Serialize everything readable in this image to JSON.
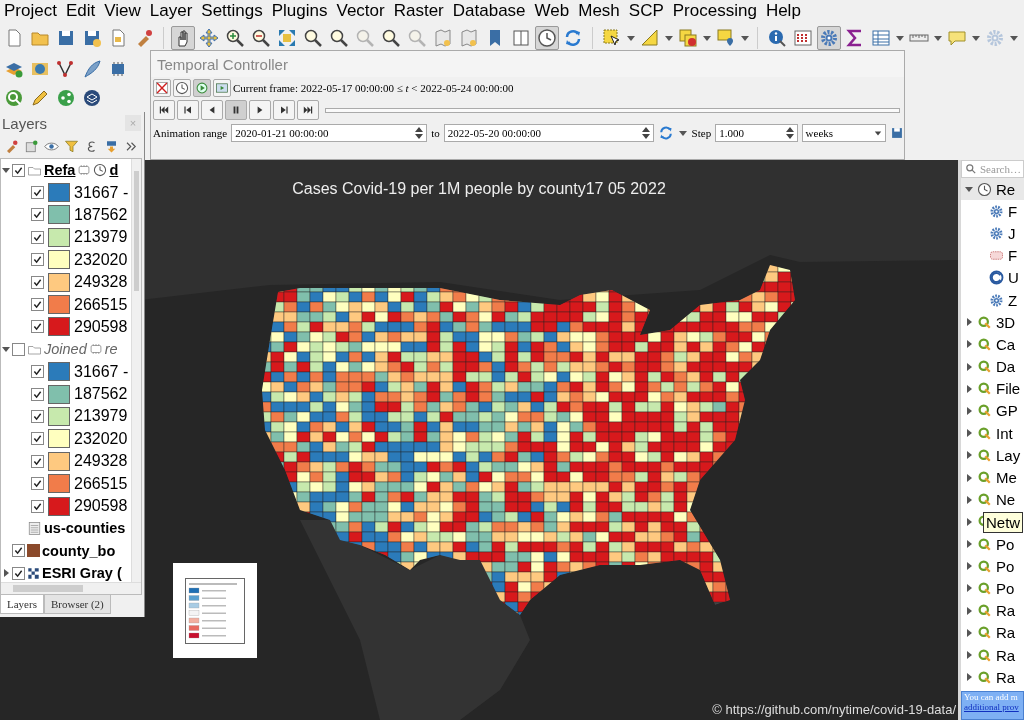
{
  "menu": [
    "Project",
    "Edit",
    "View",
    "Layer",
    "Settings",
    "Plugins",
    "Vector",
    "Raster",
    "Database",
    "Web",
    "Mesh",
    "SCP",
    "Processing",
    "Help"
  ],
  "toolbar": [
    {
      "pressed": false,
      "disabled": false
    },
    {
      "pressed": false,
      "disabled": false
    },
    {
      "pressed": false,
      "disabled": false
    },
    {
      "pressed": false,
      "disabled": false
    },
    {
      "pressed": false,
      "disabled": false
    },
    {
      "pressed": false,
      "disabled": false
    },
    {
      "pressed": true,
      "disabled": false
    },
    {
      "pressed": false,
      "disabled": false
    },
    {
      "pressed": false,
      "disabled": false
    },
    {
      "pressed": false,
      "disabled": false
    },
    {
      "pressed": false,
      "disabled": false
    },
    {
      "pressed": false,
      "disabled": false
    },
    {
      "pressed": false,
      "disabled": false
    },
    {
      "pressed": false,
      "disabled": true
    },
    {
      "pressed": false,
      "disabled": false
    },
    {
      "pressed": false,
      "disabled": true
    },
    {
      "pressed": false,
      "disabled": false
    },
    {
      "pressed": false,
      "disabled": false
    },
    {
      "pressed": false,
      "disabled": false
    },
    {
      "pressed": false,
      "disabled": false
    },
    {
      "pressed": true,
      "disabled": false
    },
    {
      "pressed": false,
      "disabled": false
    },
    {
      "pressed": false,
      "disabled": false
    },
    {
      "pressed": false,
      "disabled": false
    },
    {
      "pressed": false,
      "disabled": false
    },
    {
      "pressed": false,
      "disabled": false
    },
    {
      "pressed": false,
      "disabled": false
    },
    {
      "pressed": false,
      "disabled": false
    },
    {
      "pressed": true,
      "disabled": false
    },
    {
      "pressed": false,
      "disabled": false
    },
    {
      "pressed": false,
      "disabled": false
    },
    {
      "pressed": false,
      "disabled": false
    },
    {
      "pressed": false,
      "disabled": false
    },
    {
      "pressed": false,
      "disabled": true
    }
  ],
  "temporal": {
    "title": "Temporal Controller",
    "mode_buttons": [
      {
        "pressed": false
      },
      {
        "pressed": false
      },
      {
        "pressed": true
      },
      {
        "pressed": false
      }
    ],
    "current_frame": "Current frame: 2022-05-17 00:00:00 ≤ *t* < 2022-05-24 00:00:00",
    "timeline": {
      "level": 0
    },
    "playback_buttons": [
      {
        "pressed": false
      },
      {
        "pressed": false
      },
      {
        "pressed": false
      },
      {
        "pressed": true
      },
      {
        "pressed": false
      },
      {
        "pressed": false
      },
      {
        "pressed": false
      }
    ],
    "range_label": "Animation range",
    "range_start": "2020-01-21 00:00:00",
    "to_label": "to",
    "range_end": "2022-05-20 00:00:00",
    "step_label": "Step",
    "step": "1.000",
    "step_unit": "weeks"
  },
  "layers": {
    "title": "Layers",
    "close": "×",
    "tree": [
      {
        "kind": "group",
        "name": "Refa",
        "name_tail": "d",
        "checked": true,
        "expanded": true,
        "current": true,
        "temporal": true,
        "children": [
          {
            "label": "31667 -",
            "color": "#2b7bba",
            "checked": true
          },
          {
            "label": "187562",
            "color": "#80bfac",
            "checked": true
          },
          {
            "label": "213979",
            "color": "#c7e9ad",
            "checked": true
          },
          {
            "label": "232020",
            "color": "#ffffbf",
            "checked": true
          },
          {
            "label": "249328",
            "color": "#fec980",
            "checked": true
          },
          {
            "label": "266515",
            "color": "#f17c4a",
            "checked": true
          },
          {
            "label": "290598",
            "color": "#d7191c",
            "checked": true
          }
        ]
      },
      {
        "kind": "group",
        "name": "Joined",
        "name_tail": "re",
        "checked": false,
        "expanded": true,
        "current": false,
        "temporal": false,
        "children": [
          {
            "label": "31667 -",
            "color": "#2b7bba",
            "checked": true
          },
          {
            "label": "187562",
            "color": "#80bfac",
            "checked": true
          },
          {
            "label": "213979",
            "color": "#c7e9ad",
            "checked": true
          },
          {
            "label": "232020",
            "color": "#ffffbf",
            "checked": true
          },
          {
            "label": "249328",
            "color": "#fec980",
            "checked": true
          },
          {
            "label": "266515",
            "color": "#f17c4a",
            "checked": true
          },
          {
            "label": "290598",
            "color": "#d7191c",
            "checked": true
          }
        ]
      },
      {
        "kind": "table",
        "name": "us-counties"
      },
      {
        "kind": "vector",
        "name": "county_bo",
        "checked": true,
        "color": "#8b4a2b"
      },
      {
        "kind": "raster",
        "name": "ESRI Gray (",
        "checked": true,
        "expanded": false
      }
    ],
    "tabs": [
      {
        "label": "Layers",
        "selected": true
      },
      {
        "label": "Browser (2)",
        "selected": false
      }
    ]
  },
  "map": {
    "title": "Cases Covid-19 per 1M people by county17 05 2022",
    "attribution": "© https://github.com/nytime/covid-19-data/"
  },
  "browser": {
    "search_placeholder": "Search…",
    "items": [
      {
        "kind": "recent",
        "label": "Re",
        "expanded": true,
        "children": [
          {
            "kind": "gear",
            "label": "F"
          },
          {
            "kind": "gear",
            "label": "J"
          },
          {
            "kind": "grid",
            "label": "F"
          },
          {
            "kind": "globe",
            "label": "U"
          },
          {
            "kind": "gear",
            "label": "Z"
          }
        ]
      },
      {
        "kind": "qgis",
        "label": "3D",
        "expanded": false
      },
      {
        "kind": "qgis",
        "label": "Ca",
        "expanded": false
      },
      {
        "kind": "qgis",
        "label": "Da",
        "expanded": false
      },
      {
        "kind": "qgis",
        "label": "File",
        "expanded": false
      },
      {
        "kind": "qgis",
        "label": "GP",
        "expanded": false
      },
      {
        "kind": "qgis",
        "label": "Int",
        "expanded": false
      },
      {
        "kind": "qgis",
        "label": "Lay",
        "expanded": false
      },
      {
        "kind": "qgis",
        "label": "Me",
        "expanded": false
      },
      {
        "kind": "qgis",
        "label": "Ne",
        "expanded": false
      },
      {
        "kind": "qgis",
        "tooltip": "Netw",
        "expanded": false
      },
      {
        "kind": "qgis",
        "label": "Po",
        "expanded": false
      },
      {
        "kind": "qgis",
        "label": "Po",
        "expanded": false
      },
      {
        "kind": "qgis",
        "label": "Po",
        "expanded": false
      },
      {
        "kind": "qgis",
        "label": "Ra",
        "expanded": false
      },
      {
        "kind": "qgis",
        "label": "Ra",
        "expanded": false
      },
      {
        "kind": "qgis",
        "label": "Ra",
        "expanded": false
      },
      {
        "kind": "qgis",
        "label": "Ra",
        "expanded": false
      }
    ],
    "info": {
      "text": "You can add m",
      "link": "additional prov"
    }
  }
}
